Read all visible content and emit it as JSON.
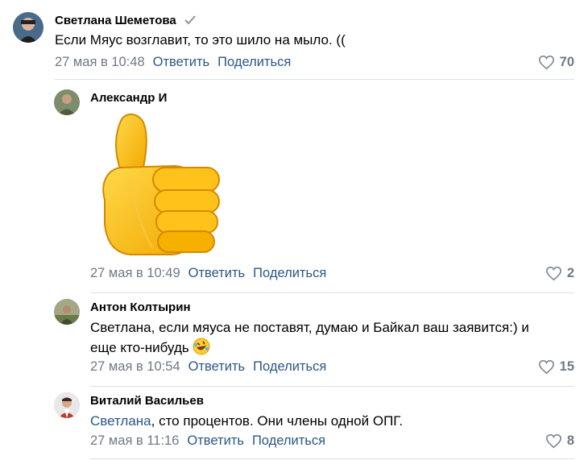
{
  "ui": {
    "reply_label": "Ответить",
    "share_label": "Поделиться",
    "link_color": "#2a5885",
    "muted_color": "#6f7985"
  },
  "comments": [
    {
      "author": "Светлана Шеметова",
      "verified": true,
      "text": "Если Мяус возглавит, то это шило на мыло. ((",
      "date": "27 мая в 10:48",
      "likes": "70"
    },
    {
      "author": "Александр И",
      "sticker": "thumbs-up",
      "date": "27 мая в 10:49",
      "likes": "2"
    },
    {
      "author": "Антон Колтырин",
      "text_line1": "Светлана, если мяуса не поставят, думаю и Байкал ваш заявится:) и",
      "text_line2": "еще кто-нибудь",
      "emoji": "rofl",
      "date": "27 мая в 10:54",
      "likes": "15"
    },
    {
      "author": "Виталий Васильев",
      "mention": "Светлана",
      "text_rest": ", сто процентов. Они члены одной ОПГ.",
      "date": "27 мая в 11:16",
      "likes": "8"
    }
  ]
}
